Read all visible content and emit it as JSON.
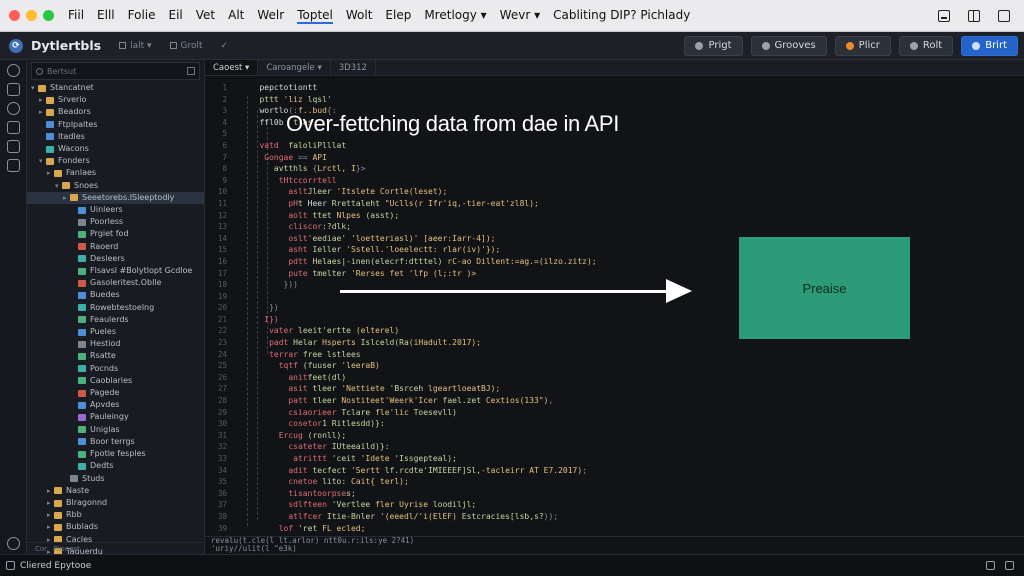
{
  "menubar": {
    "items": [
      "Fiil",
      "Elll",
      "Folie",
      "Eil",
      "Vet",
      "Alt",
      "Welr",
      "Toptel",
      "Wolt",
      "Elep",
      "Mretlogy ▾",
      "Wevr ▾",
      "Cabliting DIP? Pichlady"
    ]
  },
  "toolbar": {
    "app_name": "Dytlertbls",
    "small_items": [
      "lalt ▾",
      "Grolt"
    ],
    "buttons": [
      "Prigt",
      "Grooves",
      "Plicr",
      "Rolt",
      "Brirt"
    ]
  },
  "sidebar": {
    "search_placeholder": "Bertsut",
    "tree": [
      {
        "label": "Stancatnet",
        "icon": "folder",
        "indent": 0,
        "open": true
      },
      {
        "label": "Srverio",
        "icon": "folder",
        "indent": 1
      },
      {
        "label": "Beadors",
        "icon": "folder",
        "indent": 1
      },
      {
        "label": "Ftplpaltes",
        "icon": "blue",
        "indent": 1
      },
      {
        "label": "Itadles",
        "icon": "blue",
        "indent": 1
      },
      {
        "label": "Wacons",
        "icon": "teal",
        "indent": 1
      },
      {
        "label": "Fonders",
        "icon": "folder",
        "indent": 1,
        "open": true
      },
      {
        "label": "Fanlaes",
        "icon": "folder",
        "indent": 2
      },
      {
        "label": "Snoes",
        "icon": "folder",
        "indent": 3,
        "open": true
      },
      {
        "label": "Seeetorebs.ISleeptodly",
        "icon": "folder",
        "indent": 4,
        "selected": true
      },
      {
        "label": "Uinleers",
        "icon": "blue",
        "indent": 5
      },
      {
        "label": "Poorless",
        "icon": "grey",
        "indent": 5
      },
      {
        "label": "Prgiet fod",
        "icon": "green",
        "indent": 5
      },
      {
        "label": "Raoerd",
        "icon": "red",
        "indent": 5
      },
      {
        "label": "Desleers",
        "icon": "teal",
        "indent": 5
      },
      {
        "label": "Flsavsl #Bolytlopt Gcdloe",
        "icon": "green",
        "indent": 5
      },
      {
        "label": "Gasoleritest.Oblle",
        "icon": "red",
        "indent": 5
      },
      {
        "label": "Buedes",
        "icon": "blue",
        "indent": 5
      },
      {
        "label": "Rowebtestoelng",
        "icon": "teal",
        "indent": 5
      },
      {
        "label": "Feaulerds",
        "icon": "green",
        "indent": 5
      },
      {
        "label": "Pueles",
        "icon": "blue",
        "indent": 5
      },
      {
        "label": "Hestiod",
        "icon": "grey",
        "indent": 5
      },
      {
        "label": "Rsatte",
        "icon": "green",
        "indent": 5
      },
      {
        "label": "Pocnds",
        "icon": "teal",
        "indent": 5
      },
      {
        "label": "Caoblaries",
        "icon": "green",
        "indent": 5
      },
      {
        "label": "Pagede",
        "icon": "red",
        "indent": 5
      },
      {
        "label": "Apvdes",
        "icon": "blue",
        "indent": 5
      },
      {
        "label": "Pauleingy",
        "icon": "purple",
        "indent": 5
      },
      {
        "label": "Uniglas",
        "icon": "green",
        "indent": 5
      },
      {
        "label": "Boor terrgs",
        "icon": "blue",
        "indent": 5
      },
      {
        "label": "Fpotle fesples",
        "icon": "green",
        "indent": 5
      },
      {
        "label": "Dedts",
        "icon": "teal",
        "indent": 5
      },
      {
        "label": "Studs",
        "icon": "grey",
        "indent": 4
      },
      {
        "label": "Naste",
        "icon": "folder",
        "indent": 2
      },
      {
        "label": "Blragonnd",
        "icon": "folder",
        "indent": 2
      },
      {
        "label": "Rbb",
        "icon": "folder",
        "indent": 2
      },
      {
        "label": "Bublads",
        "icon": "folder",
        "indent": 2
      },
      {
        "label": "Cacles",
        "icon": "folder",
        "indent": 2
      },
      {
        "label": "Taguerdu",
        "icon": "folder",
        "indent": 2
      }
    ],
    "footer": [
      "Cor",
      "Plisoest"
    ]
  },
  "editor": {
    "tabs": [
      "Caoest ▾",
      "Caroangele ▾",
      "3D312"
    ],
    "code_lines": [
      [
        {
          "t": "p",
          "x": "   "
        },
        {
          "t": "v",
          "x": "pepctotiontt"
        }
      ],
      [
        {
          "t": "p",
          "x": "   "
        },
        {
          "t": "s",
          "x": "pttt "
        },
        {
          "t": "f",
          "x": "'liz "
        },
        {
          "t": "s",
          "x": "lqsl'"
        }
      ],
      [
        {
          "t": "p",
          "x": "   "
        },
        {
          "t": "v",
          "x": "wortlo"
        },
        {
          "t": "p",
          "x": "(:"
        },
        {
          "t": "f",
          "x": "f..bud"
        },
        {
          "t": "p",
          "x": "{:"
        }
      ],
      [
        {
          "t": "p",
          "x": "   "
        },
        {
          "t": "v",
          "x": "ffl0b"
        },
        {
          "t": "p",
          "x": "  "
        },
        {
          "t": "s",
          "x": "tlas"
        }
      ],
      [],
      [
        {
          "t": "p",
          "x": "   "
        },
        {
          "t": "k",
          "x": "vatd"
        },
        {
          "t": "p",
          "x": "  "
        },
        {
          "t": "s",
          "x": "faloliPlllat"
        }
      ],
      [
        {
          "t": "p",
          "x": "    "
        },
        {
          "t": "k",
          "x": "Gongae"
        },
        {
          "t": "p",
          "x": " == "
        },
        {
          "t": "f",
          "x": "API"
        }
      ],
      [
        {
          "t": "p",
          "x": "      "
        },
        {
          "t": "s",
          "x": "avtthls "
        },
        {
          "t": "p",
          "x": "{"
        },
        {
          "t": "f",
          "x": "Lrctl, I"
        },
        {
          "t": "p",
          "x": "}>"
        }
      ],
      [
        {
          "t": "p",
          "x": "       "
        },
        {
          "t": "k",
          "x": "tHtccorrtell"
        }
      ],
      [
        {
          "t": "p",
          "x": "         "
        },
        {
          "t": "k",
          "x": "aslt"
        },
        {
          "t": "s",
          "x": "Jleer "
        },
        {
          "t": "f",
          "x": "'Itslete Cortle(leset);"
        }
      ],
      [
        {
          "t": "p",
          "x": "         "
        },
        {
          "t": "k",
          "x": "pH"
        },
        {
          "t": "s",
          "x": "t "
        },
        {
          "t": "v",
          "x": "Heer"
        },
        {
          "t": "s",
          "x": " Rrettaleht "
        },
        {
          "t": "f",
          "x": "\"Uclls(r Ifr'iq,-tier-eat'zl8l);"
        }
      ],
      [
        {
          "t": "p",
          "x": "         "
        },
        {
          "t": "k",
          "x": "aolt"
        },
        {
          "t": "s",
          "x": " ttet "
        },
        {
          "t": "f",
          "x": "Nlpes "
        },
        {
          "t": "s",
          "x": "(asst);"
        }
      ],
      [
        {
          "t": "p",
          "x": "         "
        },
        {
          "t": "k",
          "x": "cliscor"
        },
        {
          "t": "s",
          "x": ":?dlk;"
        }
      ],
      [
        {
          "t": "p",
          "x": "         "
        },
        {
          "t": "k",
          "x": "oslt"
        },
        {
          "t": "s",
          "x": "'eediae' "
        },
        {
          "t": "f",
          "x": "'loetteriasl)' [aeer:Iarr-4]);"
        }
      ],
      [
        {
          "t": "p",
          "x": "         "
        },
        {
          "t": "k",
          "x": "asht"
        },
        {
          "t": "s",
          "x": " Ieller "
        },
        {
          "t": "f",
          "x": "'Sstell.'loeelectt: rlar(iv)'});"
        }
      ],
      [
        {
          "t": "p",
          "x": "         "
        },
        {
          "t": "k",
          "x": "pdtt"
        },
        {
          "t": "s",
          "x": " Helaes|-inen(elecrf:dtttel)"
        },
        {
          "t": "f",
          "x": " rC-ao Dillent:=ag.=(ilzo.zitz);"
        }
      ],
      [
        {
          "t": "p",
          "x": "         "
        },
        {
          "t": "k",
          "x": "pute"
        },
        {
          "t": "s",
          "x": " tmelter "
        },
        {
          "t": "f",
          "x": "'Rerses fet 'lfp (l;:tr )>"
        }
      ],
      [
        {
          "t": "p",
          "x": "        "
        },
        {
          "t": "p",
          "x": "}))"
        }
      ],
      [],
      [
        {
          "t": "p",
          "x": "     "
        },
        {
          "t": "p",
          "x": "})"
        }
      ],
      [
        {
          "t": "p",
          "x": "    "
        },
        {
          "t": "k",
          "x": "I})"
        }
      ],
      [
        {
          "t": "p",
          "x": "     "
        },
        {
          "t": "k",
          "x": "vater"
        },
        {
          "t": "s",
          "x": " leeit'ertte "
        },
        {
          "t": "f",
          "x": "(elterel)"
        }
      ],
      [
        {
          "t": "p",
          "x": "     "
        },
        {
          "t": "k",
          "x": "padt"
        },
        {
          "t": "s",
          "x": " Helar "
        },
        {
          "t": "f",
          "x": "Hsperts "
        },
        {
          "t": "s",
          "x": "Islceld(Ra"
        },
        {
          "t": "f",
          "x": "(iHadult.2017);"
        }
      ],
      [
        {
          "t": "p",
          "x": "     "
        },
        {
          "t": "k",
          "x": "terrar"
        },
        {
          "t": "s",
          "x": " free lstlees"
        }
      ],
      [
        {
          "t": "p",
          "x": "       "
        },
        {
          "t": "k",
          "x": "tqtf"
        },
        {
          "t": "s",
          "x": " (fuuser "
        },
        {
          "t": "f",
          "x": "'leeraB)"
        }
      ],
      [
        {
          "t": "p",
          "x": "         "
        },
        {
          "t": "k",
          "x": "anit"
        },
        {
          "t": "s",
          "x": "feet(dl)"
        }
      ],
      [
        {
          "t": "p",
          "x": "         "
        },
        {
          "t": "k",
          "x": "asit"
        },
        {
          "t": "s",
          "x": " tleer "
        },
        {
          "t": "f",
          "x": "'Nettiete "
        },
        {
          "t": "s",
          "x": "'Bsrceh "
        },
        {
          "t": "f",
          "x": "lgeartloeatBJ);"
        }
      ],
      [
        {
          "t": "p",
          "x": "         "
        },
        {
          "t": "k",
          "x": "patt"
        },
        {
          "t": "s",
          "x": " tleer "
        },
        {
          "t": "f",
          "x": "Nostiteet'Weerk'Icer "
        },
        {
          "t": "s",
          "x": "fael.zet "
        },
        {
          "t": "f",
          "x": "Cextios(133\")"
        },
        {
          "t": "p",
          "x": ","
        }
      ],
      [
        {
          "t": "p",
          "x": "         "
        },
        {
          "t": "k",
          "x": "csiaorieer"
        },
        {
          "t": "s",
          "x": " Tclare "
        },
        {
          "t": "f",
          "x": "fle'lic "
        },
        {
          "t": "s",
          "x": "Toesevll)"
        }
      ],
      [
        {
          "t": "p",
          "x": "         "
        },
        {
          "t": "k",
          "x": "cosetor"
        },
        {
          "t": "s",
          "x": "1 Ritlesdd)}:"
        }
      ],
      [
        {
          "t": "p",
          "x": "       "
        },
        {
          "t": "k",
          "x": "Ercug"
        },
        {
          "t": "s",
          "x": " (ronll);"
        }
      ],
      [
        {
          "t": "p",
          "x": "         "
        },
        {
          "t": "k",
          "x": "csateter"
        },
        {
          "t": "s",
          "x": " IUteeaild)}:"
        }
      ],
      [
        {
          "t": "p",
          "x": "          "
        },
        {
          "t": "k",
          "x": "atrittt"
        },
        {
          "t": "s",
          "x": " 'ceit "
        },
        {
          "t": "f",
          "x": "'Idete "
        },
        {
          "t": "s",
          "x": "'Issgepteal);"
        }
      ],
      [
        {
          "t": "p",
          "x": "         "
        },
        {
          "t": "k",
          "x": "adit"
        },
        {
          "t": "s",
          "x": " tecfect "
        },
        {
          "t": "f",
          "x": "'Sertt "
        },
        {
          "t": "s",
          "x": "lf.rcdte'IMIEEEF]Sl,"
        },
        {
          "t": "f",
          "x": "-tacleirr AT E7.2017)"
        },
        {
          "t": "p",
          "x": ";"
        }
      ],
      [
        {
          "t": "p",
          "x": "         "
        },
        {
          "t": "k",
          "x": "cnetoe"
        },
        {
          "t": "s",
          "x": " lito: "
        },
        {
          "t": "f",
          "x": "Cait{ terl);"
        }
      ],
      [
        {
          "t": "p",
          "x": "         "
        },
        {
          "t": "k",
          "x": "tisantoorpse"
        },
        {
          "t": "s",
          "x": "s;"
        }
      ],
      [
        {
          "t": "p",
          "x": "         "
        },
        {
          "t": "k",
          "x": "sdlfteen"
        },
        {
          "t": "s",
          "x": " 'Vertlee "
        },
        {
          "t": "f",
          "x": "fler Uyrise "
        },
        {
          "t": "s",
          "x": "loodiljl;"
        }
      ],
      [
        {
          "t": "p",
          "x": "         "
        },
        {
          "t": "k",
          "x": "atlfcer"
        },
        {
          "t": "s",
          "x": " Itie-Bnler "
        },
        {
          "t": "f",
          "x": "'(eeedl/'i(ElEF) "
        },
        {
          "t": "s",
          "x": "Estcracies[lsb,s?"
        },
        {
          "t": "p",
          "x": "));"
        }
      ],
      [
        {
          "t": "p",
          "x": "       "
        },
        {
          "t": "k",
          "x": "lof"
        },
        {
          "t": "s",
          "x": " 'ret "
        },
        {
          "t": "f",
          "x": "FL ecled;"
        }
      ],
      [
        {
          "t": "p",
          "x": "     "
        },
        {
          "t": "k",
          "x": "Rverqesttilr"
        },
        {
          "t": "s",
          "x": " (eattor "
        },
        {
          "t": "f",
          "x": "'toflouio,'legesr: "
        },
        {
          "t": "s",
          "x": "Tlllfr-tocd agt"
        },
        {
          "t": "p",
          "x": "1;"
        }
      ],
      [
        {
          "t": "p",
          "x": "    "
        },
        {
          "t": "k",
          "x": "})"
        }
      ]
    ],
    "gutter": [
      "1",
      "2",
      "3",
      "4",
      "5",
      "6",
      "7",
      "8",
      "9",
      "10",
      "11",
      "12",
      "13",
      "14",
      "15",
      "16",
      "17",
      "18",
      "19",
      "20",
      "21",
      "22",
      "23",
      "24",
      "25",
      "26",
      "27",
      "28",
      "29",
      "30",
      "31",
      "32",
      "33",
      "34",
      "35",
      "36",
      "37",
      "38",
      "39",
      "40",
      "41",
      "42",
      "43",
      "44"
    ],
    "overlay_title": "Over-fettching data from dae in API",
    "box_label": "Preaise",
    "bottom_lines": [
      "revalu(t.cle(l lt.arlor) ntt0u.r:ils:ye 2?41)",
      "  'uriy//ulit(l \"e3k)"
    ]
  },
  "statusbar": {
    "left_text": "Cliered Epytooe"
  }
}
